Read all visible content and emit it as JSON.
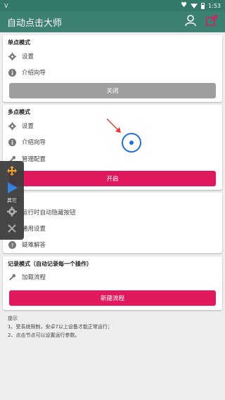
{
  "status": {
    "left": "V",
    "time": "1:53"
  },
  "appbar": {
    "title": "自动点击大师"
  },
  "single": {
    "title": "单点模式",
    "settings": "设置",
    "guide": "介绍向导",
    "close_btn": "关闭"
  },
  "multi": {
    "title": "多点模式",
    "settings": "设置",
    "guide": "介绍向导",
    "manage": "管理配置",
    "open_btn": "开启"
  },
  "other": {
    "title": "其它",
    "auto_hide": "运行时自动隐藏按钮",
    "general": "通用设置",
    "faq": "疑难解答"
  },
  "record": {
    "title": "记录模式（自动记录每一个操作）",
    "load": "加载流程",
    "new_btn": "新建流程"
  },
  "tips": {
    "title": "提示",
    "line1": "1、受系统限制，安卓7以上设备才能正常运行；",
    "line2": "2、点击节点可以设置运行参数。"
  },
  "floatbar": {
    "label": "其它"
  },
  "colors": {
    "primary": "#3c8174",
    "accent": "#e0195f",
    "target": "#1e6fd9"
  }
}
